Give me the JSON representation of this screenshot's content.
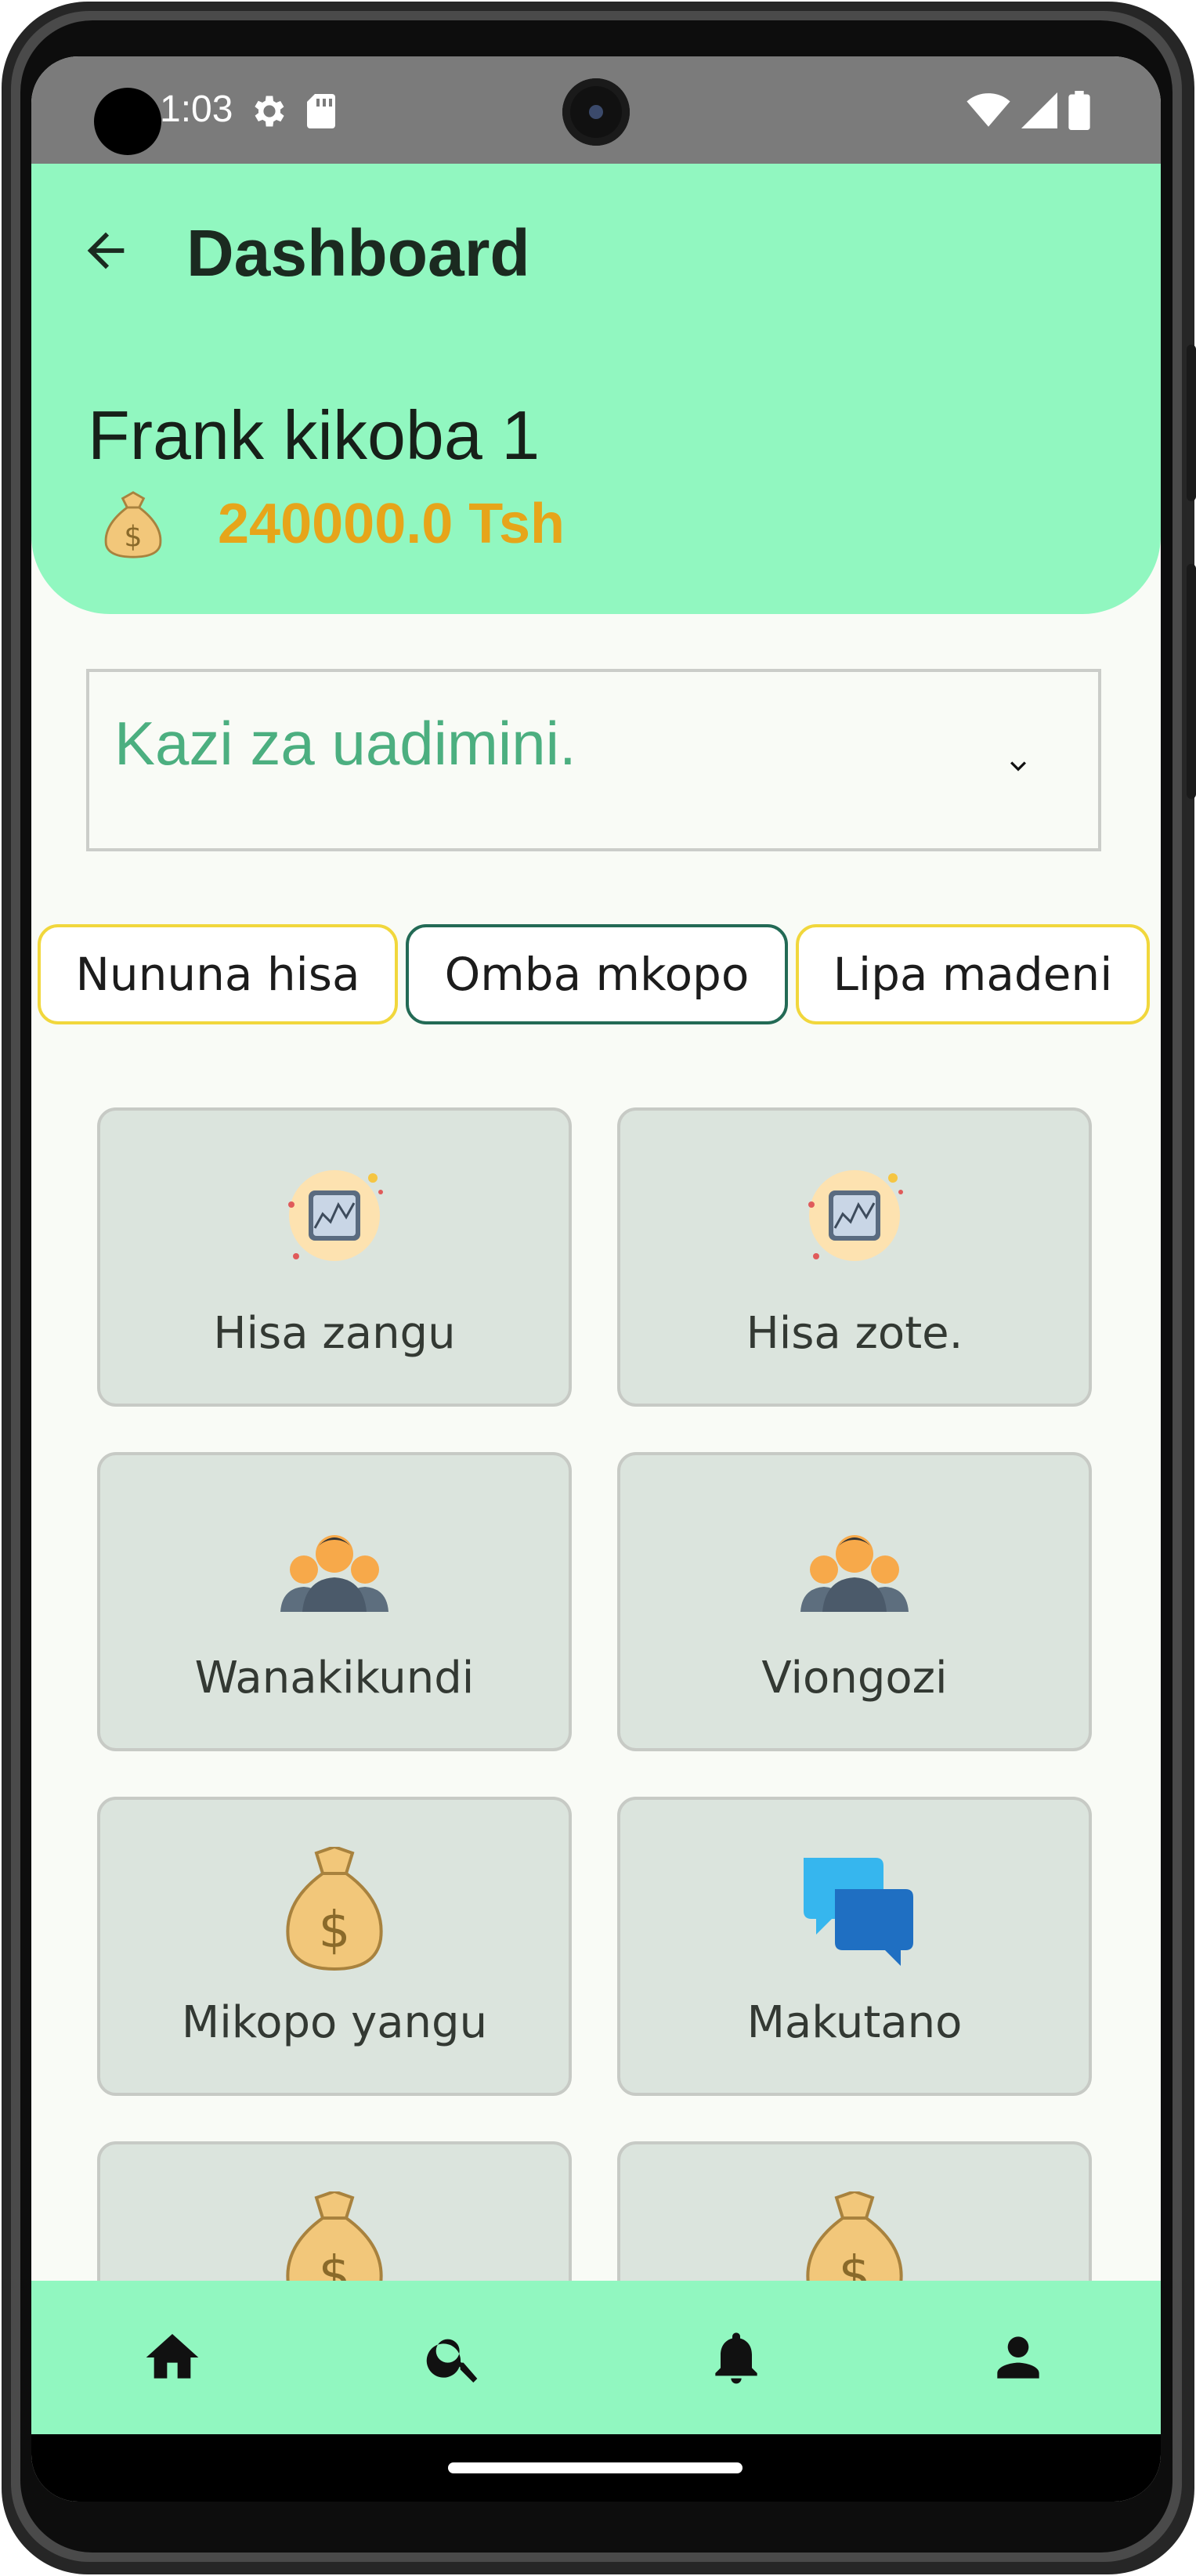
{
  "status_bar": {
    "time": "1:03"
  },
  "header": {
    "title": "Dashboard",
    "group_name": "Frank kikoba 1",
    "balance": "240000.0 Tsh",
    "background_color": "#91f7c0",
    "balance_color": "#e6a51a"
  },
  "dropdown": {
    "selected": "Kazi za uadimini."
  },
  "chips": [
    {
      "label": "Nununa hisa"
    },
    {
      "label": "Omba mkopo"
    },
    {
      "label": "Lipa madeni"
    }
  ],
  "cards": [
    {
      "label": "Hisa zangu",
      "icon": "stock-chart-icon"
    },
    {
      "label": "Hisa zote.",
      "icon": "stock-chart-icon"
    },
    {
      "label": "Wanakikundi",
      "icon": "group-people-icon"
    },
    {
      "label": "Viongozi",
      "icon": "group-people-icon"
    },
    {
      "label": "Mikopo yangu",
      "icon": "money-bag-icon"
    },
    {
      "label": "Makutano",
      "icon": "chat-bubbles-icon"
    },
    {
      "label": "",
      "icon": "money-bag-icon"
    },
    {
      "label": "",
      "icon": "money-bag-icon"
    }
  ],
  "bottom_nav": [
    {
      "icon": "home-icon"
    },
    {
      "icon": "search-icon"
    },
    {
      "icon": "bell-icon"
    },
    {
      "icon": "person-icon"
    }
  ]
}
